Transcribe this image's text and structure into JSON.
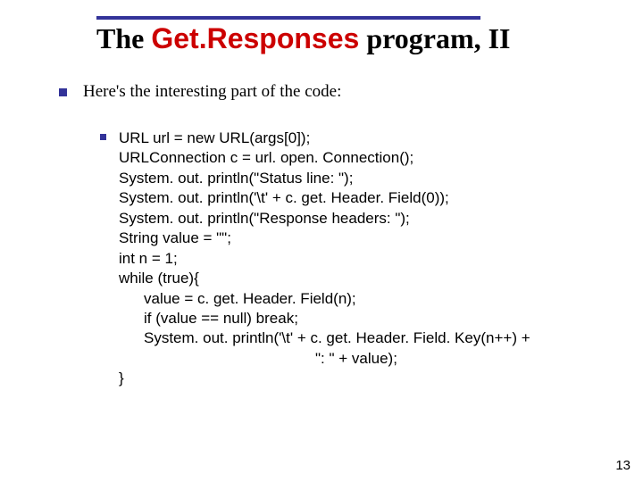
{
  "title": {
    "pre": "The ",
    "emph": "Get.Responses",
    "post": " program, II"
  },
  "intro": "Here's the interesting part of the code:",
  "code": {
    "l1": "URL url = new URL(args[0]);",
    "l2": "URLConnection c = url. open. Connection();",
    "l3": "System. out. println(\"Status line: \");",
    "l4": "System. out. println('\\t' + c. get. Header. Field(0));",
    "l5": "System. out. println(\"Response headers: \");",
    "l6": "String value = \"\";",
    "l7": "int n = 1;",
    "l8": "while (true){",
    "l9": "value = c. get. Header. Field(n);",
    "l10": "if (value == null) break;",
    "l11": "System. out. println('\\t' + c. get. Header. Field. Key(n++) +",
    "l12": "\": \" + value);",
    "l13": "}"
  },
  "page_number": "13"
}
